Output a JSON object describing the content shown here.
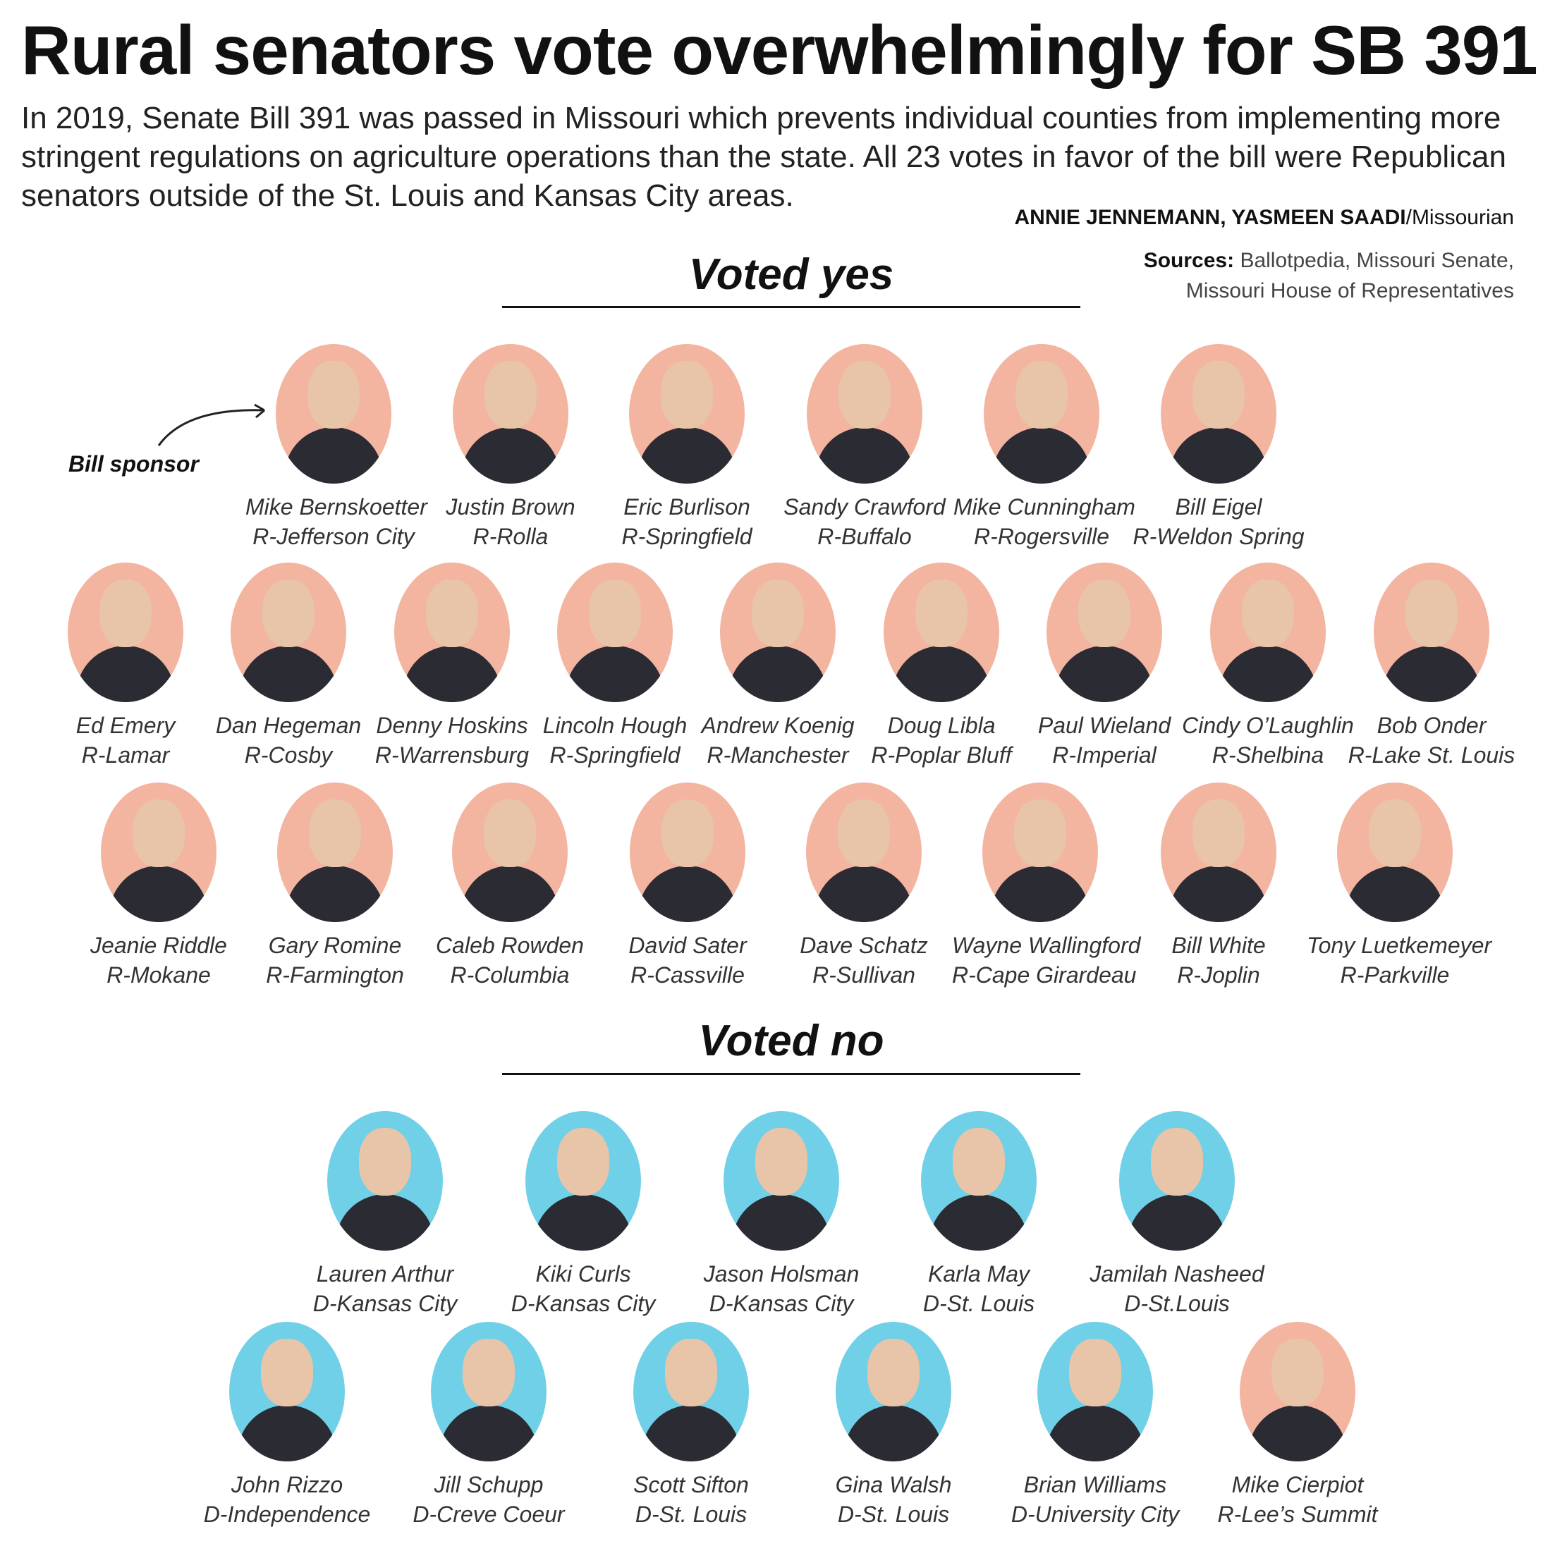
{
  "title": "Rural senators vote overwhelmingly for SB 391",
  "intro": "In 2019, Senate Bill 391 was passed in Missouri which prevents individual counties from implementing more stringent regulations on agriculture operations than the state. All 23 votes in favor of the bill were Republican senators outside of the St. Louis and Kansas City areas.",
  "credit": {
    "names": "ANNIE JENNEMANN, YASMEEN SAADI",
    "outlet": "/Missourian"
  },
  "sources": {
    "label": "Sources:",
    "line1": " Ballotpedia, Missouri Senate,",
    "line2": "Missouri House of Representatives"
  },
  "sponsor_label": "Bill sponsor",
  "colors": {
    "republican": "#f3b4a0",
    "democrat": "#6fd0e8"
  },
  "yes": {
    "title": "Voted yes",
    "senators": [
      {
        "name": "Mike Bernskoetter",
        "district": "R-Jefferson City",
        "party": "R"
      },
      {
        "name": "Justin Brown",
        "district": "R-Rolla",
        "party": "R"
      },
      {
        "name": "Eric Burlison",
        "district": "R-Springfield",
        "party": "R"
      },
      {
        "name": "Sandy Crawford",
        "district": "R-Buffalo",
        "party": "R"
      },
      {
        "name": "Mike Cunningham",
        "district": "R-Rogersville",
        "party": "R"
      },
      {
        "name": "Bill Eigel",
        "district": "R-Weldon Spring",
        "party": "R"
      },
      {
        "name": "Ed Emery",
        "district": "R-Lamar",
        "party": "R"
      },
      {
        "name": "Dan Hegeman",
        "district": "R-Cosby",
        "party": "R"
      },
      {
        "name": "Denny Hoskins",
        "district": "R-Warrensburg",
        "party": "R"
      },
      {
        "name": "Lincoln Hough",
        "district": "R-Springfield",
        "party": "R"
      },
      {
        "name": "Andrew Koenig",
        "district": "R-Manchester",
        "party": "R"
      },
      {
        "name": "Doug Libla",
        "district": "R-Poplar Bluff",
        "party": "R"
      },
      {
        "name": "Paul Wieland",
        "district": "R-Imperial",
        "party": "R"
      },
      {
        "name": "Cindy O’Laughlin",
        "district": "R-Shelbina",
        "party": "R"
      },
      {
        "name": "Bob Onder",
        "district": "R-Lake St. Louis",
        "party": "R"
      },
      {
        "name": "Jeanie Riddle",
        "district": "R-Mokane",
        "party": "R"
      },
      {
        "name": "Gary Romine",
        "district": "R-Farmington",
        "party": "R"
      },
      {
        "name": "Caleb Rowden",
        "district": "R-Columbia",
        "party": "R"
      },
      {
        "name": "David Sater",
        "district": "R-Cassville",
        "party": "R"
      },
      {
        "name": "Dave Schatz",
        "district": "R-Sullivan",
        "party": "R"
      },
      {
        "name": "Wayne Wallingford",
        "district": "R-Cape Girardeau",
        "party": "R"
      },
      {
        "name": "Bill White",
        "district": "R-Joplin",
        "party": "R"
      },
      {
        "name": "Tony Luetkemeyer",
        "district": "R-Parkville",
        "party": "R"
      }
    ]
  },
  "no": {
    "title": "Voted no",
    "senators": [
      {
        "name": "Lauren Arthur",
        "district": "D-Kansas City",
        "party": "D"
      },
      {
        "name": "Kiki Curls",
        "district": "D-Kansas City",
        "party": "D"
      },
      {
        "name": "Jason Holsman",
        "district": "D-Kansas City",
        "party": "D"
      },
      {
        "name": "Karla May",
        "district": "D-St. Louis",
        "party": "D"
      },
      {
        "name": "Jamilah Nasheed",
        "district": "D-St.Louis",
        "party": "D"
      },
      {
        "name": "John Rizzo",
        "district": "D-Independence",
        "party": "D"
      },
      {
        "name": "Jill Schupp",
        "district": "D-Creve Coeur",
        "party": "D"
      },
      {
        "name": "Scott Sifton",
        "district": "D-St. Louis",
        "party": "D"
      },
      {
        "name": "Gina Walsh",
        "district": "D-St. Louis",
        "party": "D"
      },
      {
        "name": "Brian Williams",
        "district": "D-University City",
        "party": "D"
      },
      {
        "name": "Mike Cierpiot",
        "district": "R-Lee’s Summit",
        "party": "R"
      }
    ]
  }
}
